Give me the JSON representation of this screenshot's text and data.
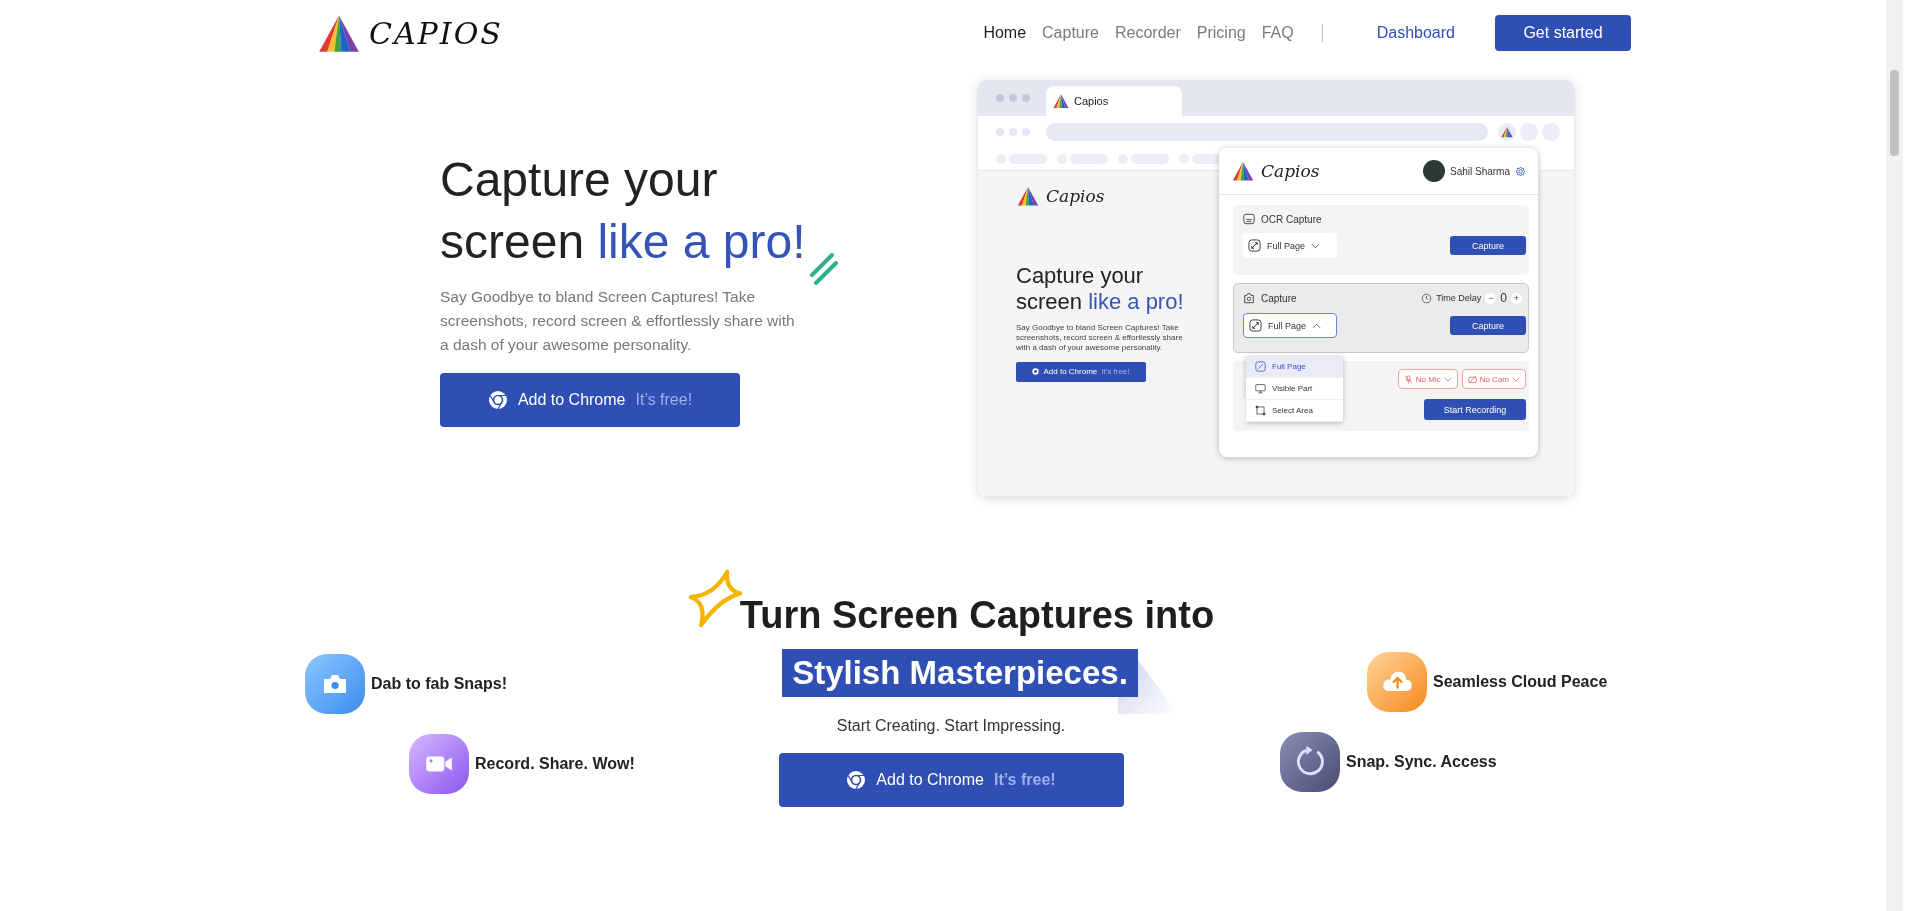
{
  "header": {
    "logo": "CAPIOS",
    "nav": [
      {
        "label": "Home",
        "selected": true
      },
      {
        "label": "Capture",
        "selected": false
      },
      {
        "label": "Recorder",
        "selected": false
      },
      {
        "label": "Pricing",
        "selected": false
      },
      {
        "label": "FAQ",
        "selected": false
      }
    ],
    "dashboard": "Dashboard",
    "cta": "Get started"
  },
  "hero": {
    "title_line1": "Capture your",
    "title_line2": "screen",
    "title_highlight": "like a pro!",
    "description": "Say Goodbye to bland Screen Captures! Take screenshots, record screen & effortlessly share with a dash of your awesome personality.",
    "button": {
      "label": "Add to Chrome",
      "note": "It’s free!"
    }
  },
  "mockup": {
    "tab_title": "Capios",
    "page_logo": "Capios",
    "page_title_line1": "Capture your",
    "page_title_line2": "screen",
    "page_title_highlight": "like a pro!",
    "page_description": "Say Goodbye to bland Screen Captures! Take screenshots, record screen & effortlessly share with a dash of your awesome personality.",
    "page_button": {
      "label": "Add to Chrome",
      "note": "It's free!"
    },
    "popup": {
      "logo": "Capios",
      "user": "Sahil Sharma",
      "ocr": {
        "title": "OCR Capture",
        "mode": "Full Page",
        "button": "Capture"
      },
      "capture": {
        "title": "Capture",
        "delay_label": "Time Delay",
        "minus": "−",
        "delay_value": "0",
        "plus": "+",
        "mode": "Full Page",
        "button": "Capture",
        "menu": [
          {
            "label": "Full Page",
            "kind": "full",
            "selected": true
          },
          {
            "label": "Visible Part",
            "kind": "visible",
            "selected": false
          },
          {
            "label": "Select Area",
            "kind": "area",
            "selected": false
          }
        ]
      },
      "record": {
        "mic": "No Mic",
        "cam": "No Cam",
        "button": "Start Recording"
      }
    }
  },
  "features": {
    "heading": "Turn Screen Captures into",
    "highlight": "Stylish Masterpieces.",
    "subtitle": "Start Creating. Start Impressing.",
    "button": {
      "label": "Add to Chrome",
      "note": "It’s free!"
    },
    "left": [
      {
        "label": "Dab to fab Snaps!",
        "kind": "camera"
      },
      {
        "label": "Record. Share. Wow!",
        "kind": "video"
      }
    ],
    "right": [
      {
        "label": "Seamless Cloud Peace",
        "kind": "cloud"
      },
      {
        "label": "Snap. Sync. Access",
        "kind": "sync"
      }
    ]
  }
}
